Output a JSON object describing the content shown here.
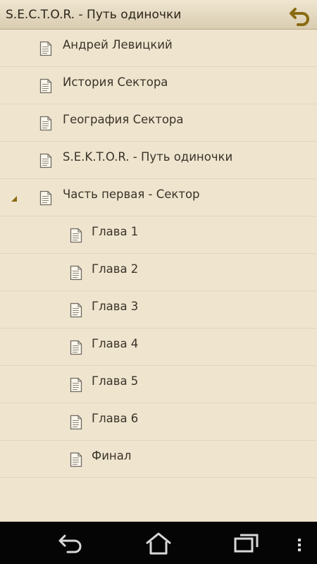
{
  "header": {
    "title": "S.E.C.T.O.R. - Путь одиночки"
  },
  "tree": {
    "items": [
      {
        "label": "Андрей Левицкий",
        "level": 0,
        "expanded": false
      },
      {
        "label": "История Сектора",
        "level": 0,
        "expanded": false
      },
      {
        "label": "География Сектора",
        "level": 0,
        "expanded": false
      },
      {
        "label": "S.E.K.T.O.R. - Путь одиночки",
        "level": 0,
        "expanded": false
      },
      {
        "label": "Часть первая - Сектор",
        "level": 0,
        "expanded": true
      },
      {
        "label": "Глава 1",
        "level": 1,
        "expanded": false
      },
      {
        "label": "Глава 2",
        "level": 1,
        "expanded": false
      },
      {
        "label": "Глава 3",
        "level": 1,
        "expanded": false
      },
      {
        "label": "Глава 4",
        "level": 1,
        "expanded": false
      },
      {
        "label": "Глава 5",
        "level": 1,
        "expanded": false
      },
      {
        "label": "Глава 6",
        "level": 1,
        "expanded": false
      },
      {
        "label": "Финал",
        "level": 1,
        "expanded": false
      }
    ]
  },
  "colors": {
    "background": "#efe5cf",
    "accent": "#8a6a10",
    "text": "#3a3328",
    "navbar": "#050505"
  },
  "icons": {
    "back": "undo-arrow-icon",
    "document": "document-icon",
    "expander": "triangle-expanded-icon",
    "nav_back": "back-icon",
    "nav_home": "home-icon",
    "nav_recent": "recent-apps-icon",
    "nav_menu": "overflow-menu-icon"
  }
}
